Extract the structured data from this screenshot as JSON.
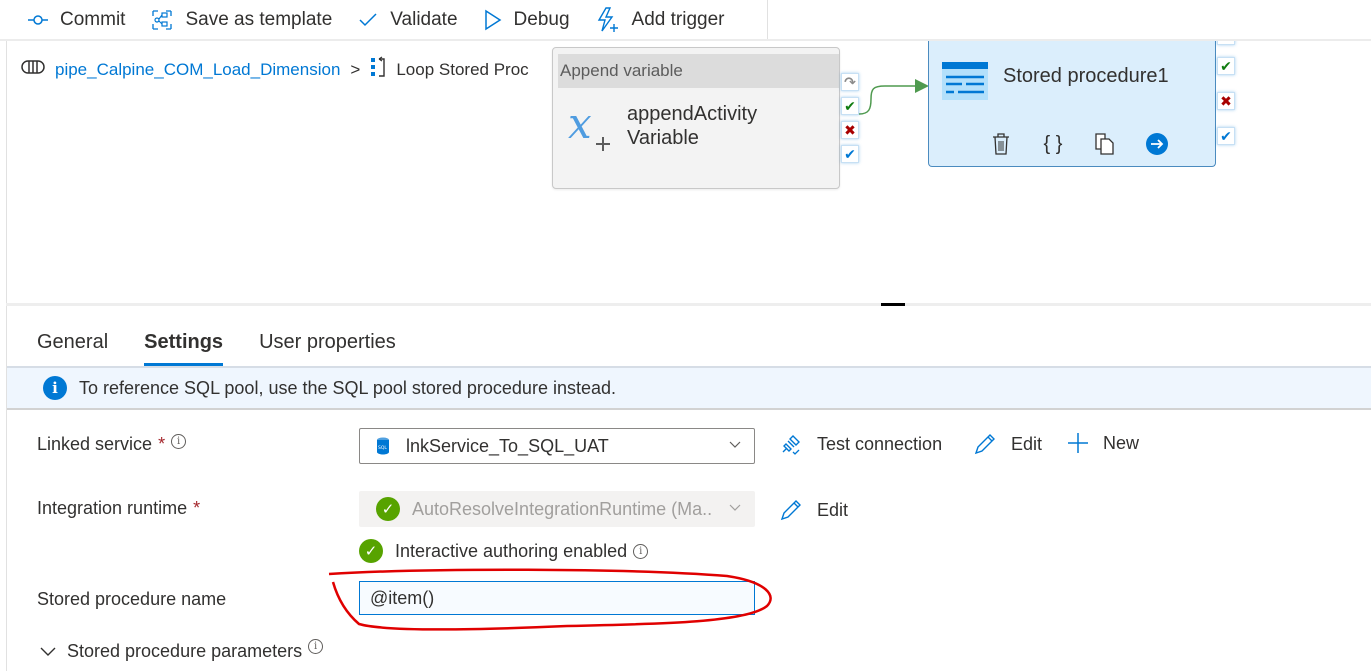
{
  "toolbar": {
    "commit": "Commit",
    "save_as_template": "Save as template",
    "validate": "Validate",
    "debug": "Debug",
    "add_trigger": "Add trigger"
  },
  "breadcrumb": {
    "pipeline": "pipe_Calpine_COM_Load_Dimension",
    "separator": ">",
    "current": "Loop Stored Proc"
  },
  "canvas": {
    "append_activity": {
      "type_label": "Append variable",
      "name_line1": "appendActivity",
      "name_line2": "Variable"
    },
    "sp_activity": {
      "name": "Stored procedure1"
    },
    "ports": {
      "skip": "↷",
      "success": "✔",
      "failure": "✖",
      "completion": "✔"
    },
    "colors": {
      "success": "#107c10",
      "failure": "#a80000",
      "completion": "#0078d4",
      "connector": "#4f9a4f",
      "accent": "#0078d4"
    }
  },
  "panel": {
    "tabs": [
      {
        "label": "General",
        "active": false
      },
      {
        "label": "Settings",
        "active": true
      },
      {
        "label": "User properties",
        "active": false
      }
    ],
    "info_message": "To reference SQL pool, use the SQL pool stored procedure instead.",
    "linked_service": {
      "label": "Linked service",
      "required": "*",
      "value": "lnkService_To_SQL_UAT",
      "test_connection": "Test connection",
      "edit": "Edit",
      "new": "New"
    },
    "integration_runtime": {
      "label": "Integration runtime",
      "required": "*",
      "value": "AutoResolveIntegrationRuntime (Ma..",
      "edit": "Edit",
      "status": "Interactive authoring enabled"
    },
    "stored_procedure_name": {
      "label": "Stored procedure name",
      "value": "@item()"
    },
    "stored_procedure_parameters": {
      "label": "Stored procedure parameters"
    }
  }
}
